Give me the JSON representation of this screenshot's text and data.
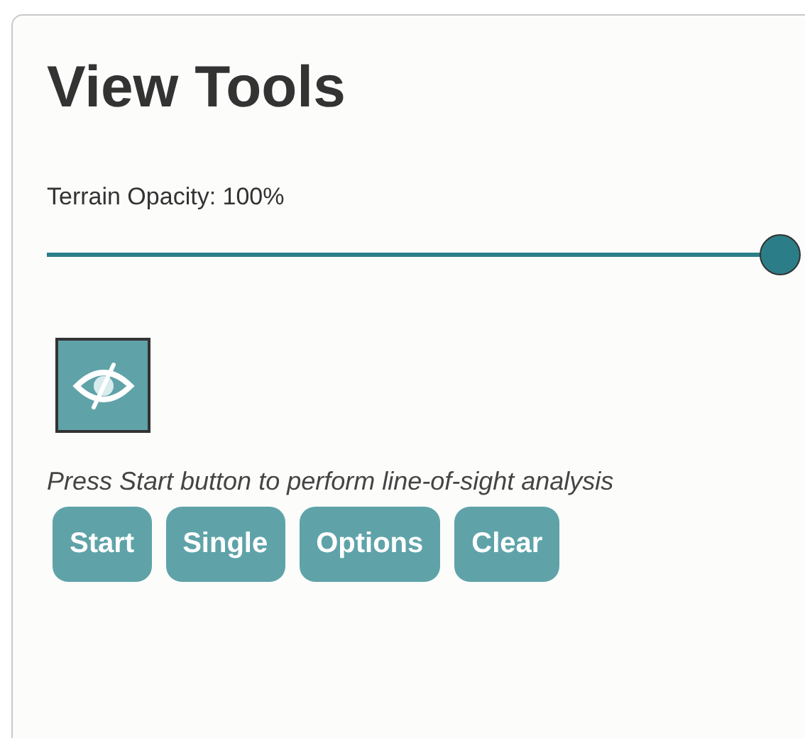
{
  "panel": {
    "title": "View Tools"
  },
  "terrain_opacity": {
    "label": "Terrain Opacity: 100%",
    "level": 1
  },
  "line_of_sight": {
    "hint": "Press Start button to perform line-of-sight analysis",
    "buttons": [
      {
        "label": "Start"
      },
      {
        "label": "Single"
      },
      {
        "label": "Options"
      },
      {
        "label": "Clear"
      }
    ]
  }
}
